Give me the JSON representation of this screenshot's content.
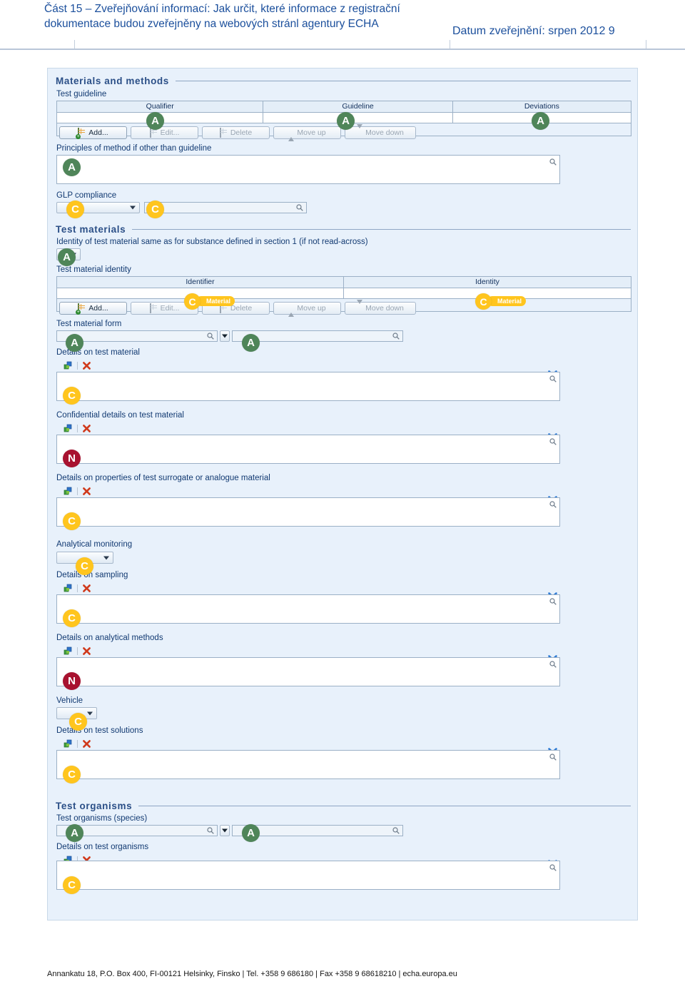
{
  "header": {
    "title": "Část 15 – Zveřejňování informací: Jak určit, které informace z registrační dokumentace budou zveřejněny na webových stránl agentury ECHA",
    "date": "Datum zveřejnění: srpen 2012  9"
  },
  "footer": {
    "text": "Annankatu 18, P.O. Box 400, FI-00121 Helsinky, Finsko | Tel. +358 9 686180 | Fax +358 9 68618210 | echa.europa.eu"
  },
  "groups": {
    "materials_and_methods": "Materials and methods",
    "test_materials": "Test materials",
    "test_organisms": "Test organisms"
  },
  "labels": {
    "test_guideline": "Test guideline",
    "principles_of_method": "Principles of method if other than guideline",
    "glp_compliance": "GLP compliance",
    "identity_same_as": "Identity of test material same as for substance defined in section 1 (if not read-across)",
    "test_material_identity": "Test material identity",
    "test_material_form": "Test material form",
    "details_on_test_material": "Details on test material",
    "confidential_details_on_test_material": "Confidential details on test material",
    "details_on_properties": "Details on properties of test surrogate or analogue material",
    "analytical_monitoring": "Analytical monitoring",
    "details_on_sampling": "Details on sampling",
    "details_on_analytical_methods": "Details on analytical methods",
    "vehicle": "Vehicle",
    "details_on_test_solutions": "Details on test solutions",
    "test_organisms_species": "Test organisms (species)",
    "details_on_test_organisms": "Details on test organisms"
  },
  "guideline_table": {
    "columns": [
      "Qualifier",
      "Guideline",
      "Deviations"
    ],
    "buttons": [
      "Add...",
      "Edit...",
      "Delete",
      "Move up",
      "Move down"
    ]
  },
  "identity_table": {
    "columns": [
      "Identifier",
      "Identity"
    ],
    "buttons": [
      "Add...",
      "Edit...",
      "Delete",
      "Move up",
      "Move down"
    ]
  },
  "markers": {
    "a": "A",
    "c": "C",
    "n": "N",
    "material_pill": "Material"
  },
  "colors": {
    "marker_a": "#4f8559",
    "marker_c": "#ffc51e",
    "marker_n": "#a81230",
    "panel_bg": "#e8f1fb",
    "header_text": "#1b4f9c",
    "label_text": "#123a72"
  },
  "icons": {
    "search": "search-icon",
    "expand": "double-chevron-down-icon",
    "insert": "insert-block-icon",
    "remove": "remove-icon",
    "dropdown": "chevron-down-icon"
  }
}
